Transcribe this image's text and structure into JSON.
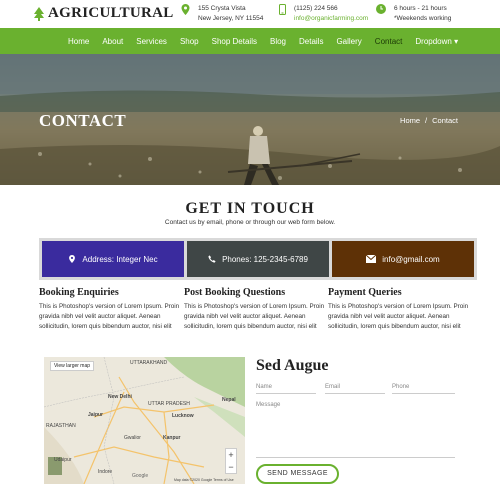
{
  "brand": {
    "name": "AGRICULTURAL"
  },
  "header": {
    "address_line1": "155 Crysta Vista",
    "address_line2": "New Jersey, NY 11554",
    "phone": "(1125) 224 566",
    "email": "info@organicfarming.com",
    "hours": "6 hours - 21 hours",
    "hours_note": "*Weekends working"
  },
  "nav": {
    "items": [
      "Home",
      "About",
      "Services",
      "Shop",
      "Shop Details",
      "Blog",
      "Details",
      "Gallery",
      "Contact",
      "Dropdown ▾"
    ],
    "active": "Contact"
  },
  "hero": {
    "title": "CONTACT",
    "crumb_home": "Home",
    "crumb_sep": "/",
    "crumb_current": "Contact"
  },
  "section": {
    "title": "GET IN TOUCH",
    "subtitle": "Contact us by email, phone or through our web form below."
  },
  "cards": [
    {
      "label": "Address: Integer Nec",
      "icon": "location-pin-icon",
      "color": "#3a2b9e"
    },
    {
      "label": "Phones: 125-2345-6789",
      "icon": "phone-icon",
      "color": "#3f4646"
    },
    {
      "label": "info@gmail.com",
      "icon": "envelope-icon",
      "color": "#5e3106"
    }
  ],
  "columns": [
    {
      "title": "Booking Enquiries",
      "text": "This is Photoshop's version of Lorem Ipsum. Proin gravida nibh vel velit auctor aliquet. Aenean sollicitudin, lorem quis bibendum auctor, nisi elit"
    },
    {
      "title": "Post Booking Questions",
      "text": "This is Photoshop's version of Lorem Ipsum. Proin gravida nibh vel velit auctor aliquet. Aenean sollicitudin, lorem quis bibendum auctor, nisi elit"
    },
    {
      "title": "Payment Queries",
      "text": "This is Photoshop's version of Lorem Ipsum. Proin gravida nibh vel velit auctor aliquet. Aenean sollicitudin, lorem quis bibendum auctor, nisi elit"
    }
  ],
  "map": {
    "view_larger": "View larger map",
    "labels": [
      "UTTARAKHAND",
      "New Delhi",
      "Jaipur",
      "UTTAR PRADESH",
      "Lucknow",
      "Nepal",
      "Kanpur",
      "Gwalior",
      "RAJASTHAN",
      "Udaipur",
      "Indore",
      "Google"
    ],
    "zoom_in": "+",
    "zoom_out": "−",
    "footer": "Map data ©2020 Google   Terms of Use"
  },
  "form": {
    "title": "Sed Augue",
    "name_placeholder": "Name",
    "email_placeholder": "Email",
    "phone_placeholder": "Phone",
    "message_placeholder": "Message",
    "send_label": "SEND MESSAGE"
  },
  "colors": {
    "accent": "#6ab12f"
  }
}
